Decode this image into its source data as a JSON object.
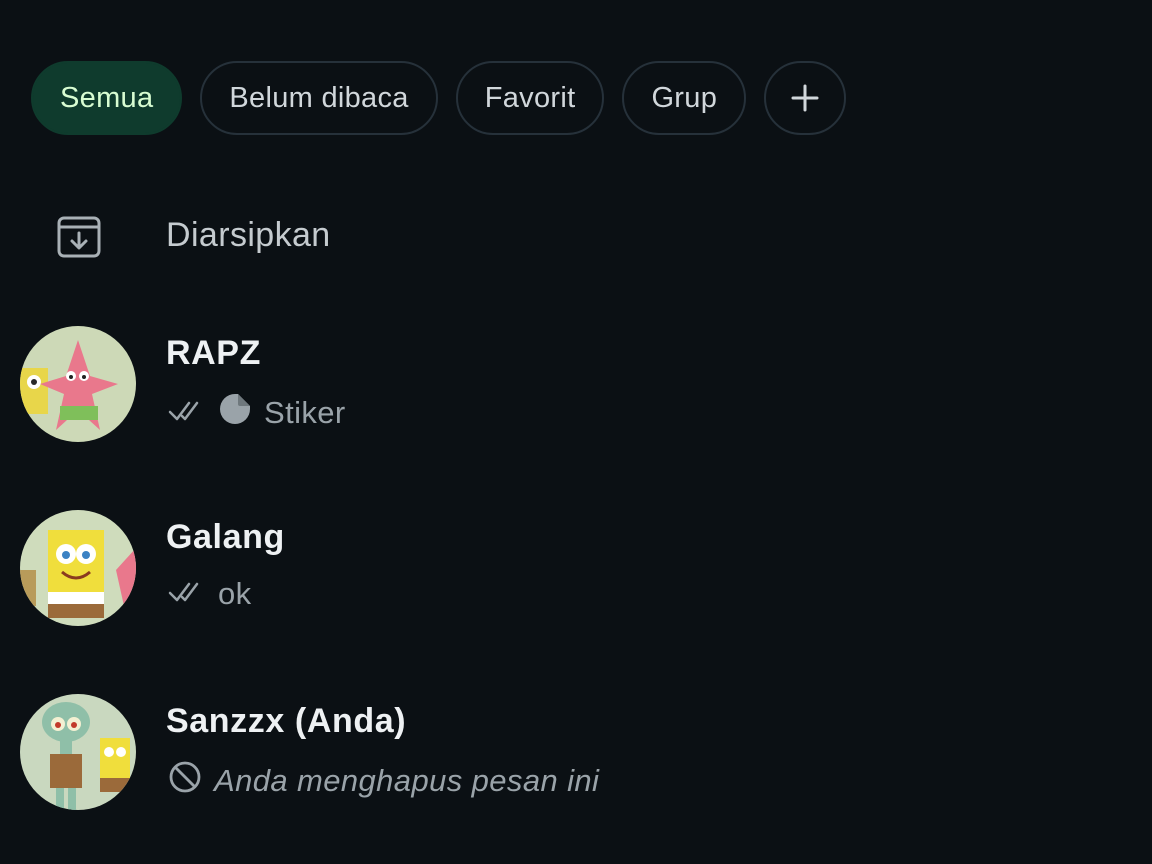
{
  "filters": {
    "items": [
      {
        "label": "Semua",
        "active": true
      },
      {
        "label": "Belum dibaca",
        "active": false
      },
      {
        "label": "Favorit",
        "active": false
      },
      {
        "label": "Grup",
        "active": false
      }
    ],
    "add_icon": "plus-icon"
  },
  "archived": {
    "label": "Diarsipkan",
    "icon": "archive-icon"
  },
  "chats": [
    {
      "name": "RAPZ",
      "preview": "Stiker",
      "status_icon": "double-check-icon",
      "type_icon": "sticker-icon"
    },
    {
      "name": "Galang",
      "preview": "ok",
      "status_icon": "double-check-icon"
    },
    {
      "name": "Sanzzx (Anda)",
      "preview": "Anda menghapus pesan ini",
      "status_icon": "blocked-icon"
    }
  ],
  "colors": {
    "background": "#0b1014",
    "active_chip_bg": "#0f3b2d",
    "active_chip_text": "#d8fdd2",
    "chip_border": "#26313a",
    "primary_text": "#eef1f3",
    "secondary_text": "#9aa3a9"
  }
}
